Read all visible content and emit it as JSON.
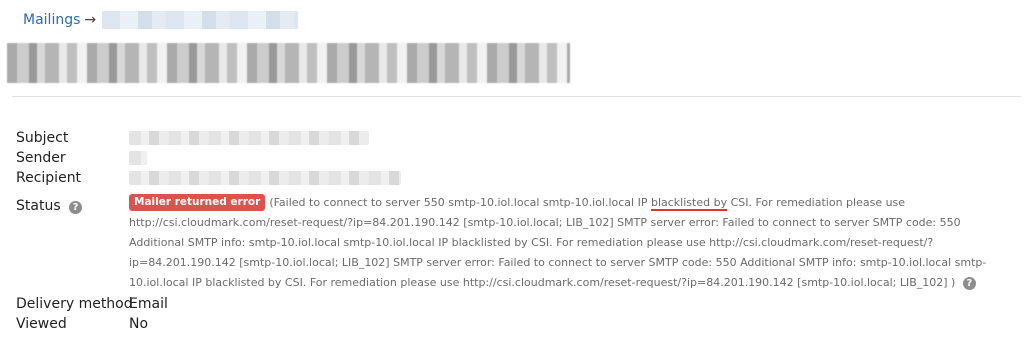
{
  "breadcrumb": {
    "root_label": "Mailings",
    "separator": "→"
  },
  "fields": {
    "subject_label": "Subject",
    "sender_label": "Sender",
    "recipient_label": "Recipient",
    "status_label": "Status",
    "delivery_method_label": "Delivery method",
    "delivery_method_value": "Email",
    "viewed_label": "Viewed",
    "viewed_value": "No"
  },
  "status": {
    "badge": "Mailer returned error",
    "message_prefix": "(Failed to connect to server 550 smtp-10.iol.local smtp-10.iol.local IP ",
    "message_highlight": "blacklisted by",
    "message_rest": " CSI. For remediation please use http://csi.cloudmark.com/reset-request/?ip=84.201.190.142 [smtp-10.iol.local; LIB_102] SMTP server error: Failed to connect to server SMTP code: 550 Additional SMTP info: smtp-10.iol.local smtp-10.iol.local IP blacklisted by CSI. For remediation please use http://csi.cloudmark.com/reset-request/?ip=84.201.190.142 [smtp-10.iol.local; LIB_102] SMTP server error: Failed to connect to server SMTP code: 550 Additional SMTP info: smtp-10.iol.local smtp-10.iol.local IP blacklisted by CSI. For remediation please use http://csi.cloudmark.com/reset-request/?ip=84.201.190.142 [smtp-10.iol.local; LIB_102] )",
    "badge_color": "#d9534f",
    "highlight_color": "#e0362c"
  },
  "icons": {
    "help_glyph": "?"
  }
}
